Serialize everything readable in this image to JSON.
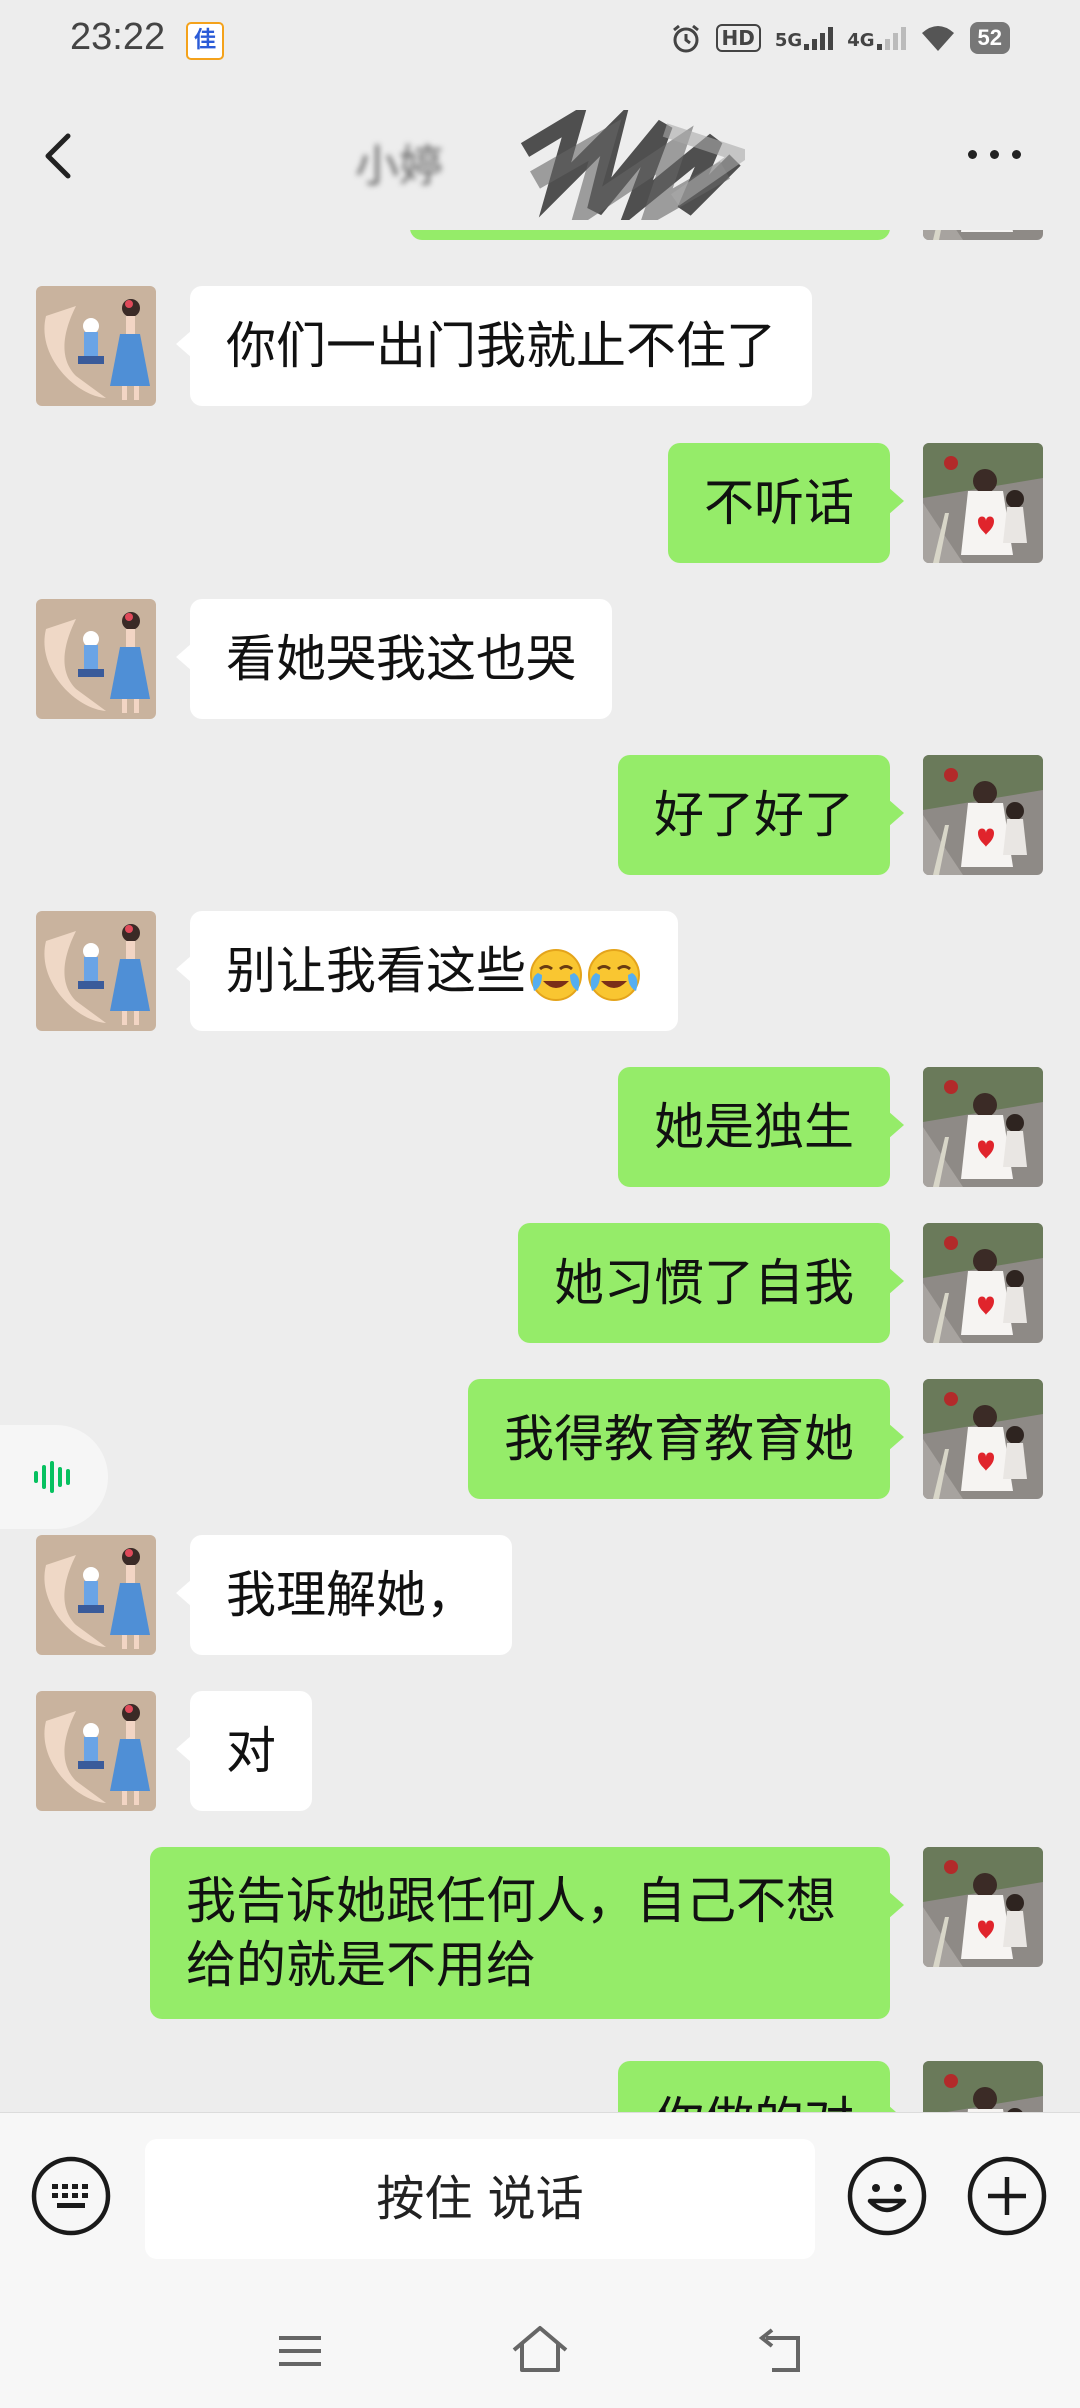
{
  "status_bar": {
    "time": "23:22",
    "app_badge": "佳",
    "hd": "HD",
    "net_5g": "5G",
    "net_4g": "4G",
    "battery": "52"
  },
  "header": {
    "title": "小婷"
  },
  "messages": [
    {
      "side": "in",
      "text": "你们一出门我就止不住了"
    },
    {
      "side": "out",
      "text": "不听话"
    },
    {
      "side": "in",
      "text": "看她哭我这也哭"
    },
    {
      "side": "out",
      "text": "好了好了"
    },
    {
      "side": "in",
      "text": "别让我看这些",
      "emoji": "loudly-crying-face"
    },
    {
      "side": "out",
      "text": "她是独生"
    },
    {
      "side": "out",
      "text": "她习惯了自我"
    },
    {
      "side": "out",
      "text": "我得教育教育她"
    },
    {
      "side": "in",
      "text": "我理解她，"
    },
    {
      "side": "in",
      "text": "对"
    },
    {
      "side": "out",
      "text": "我告诉她跟任何人，自己不想给的就是不用给"
    },
    {
      "side": "out",
      "text": "你做的对"
    }
  ],
  "input_bar": {
    "hold_to_talk": "按住 说话"
  },
  "colors": {
    "chat_background": "#ededed",
    "outgoing_bubble": "#95ec69",
    "incoming_bubble": "#ffffff",
    "voice_chip_accent": "#07c160"
  },
  "icons": [
    "back-arrow-icon",
    "more-dots-icon",
    "voice-wave-icon",
    "keyboard-icon",
    "emoji-icon",
    "plus-icon",
    "menu-icon",
    "home-icon",
    "back-icon"
  ]
}
